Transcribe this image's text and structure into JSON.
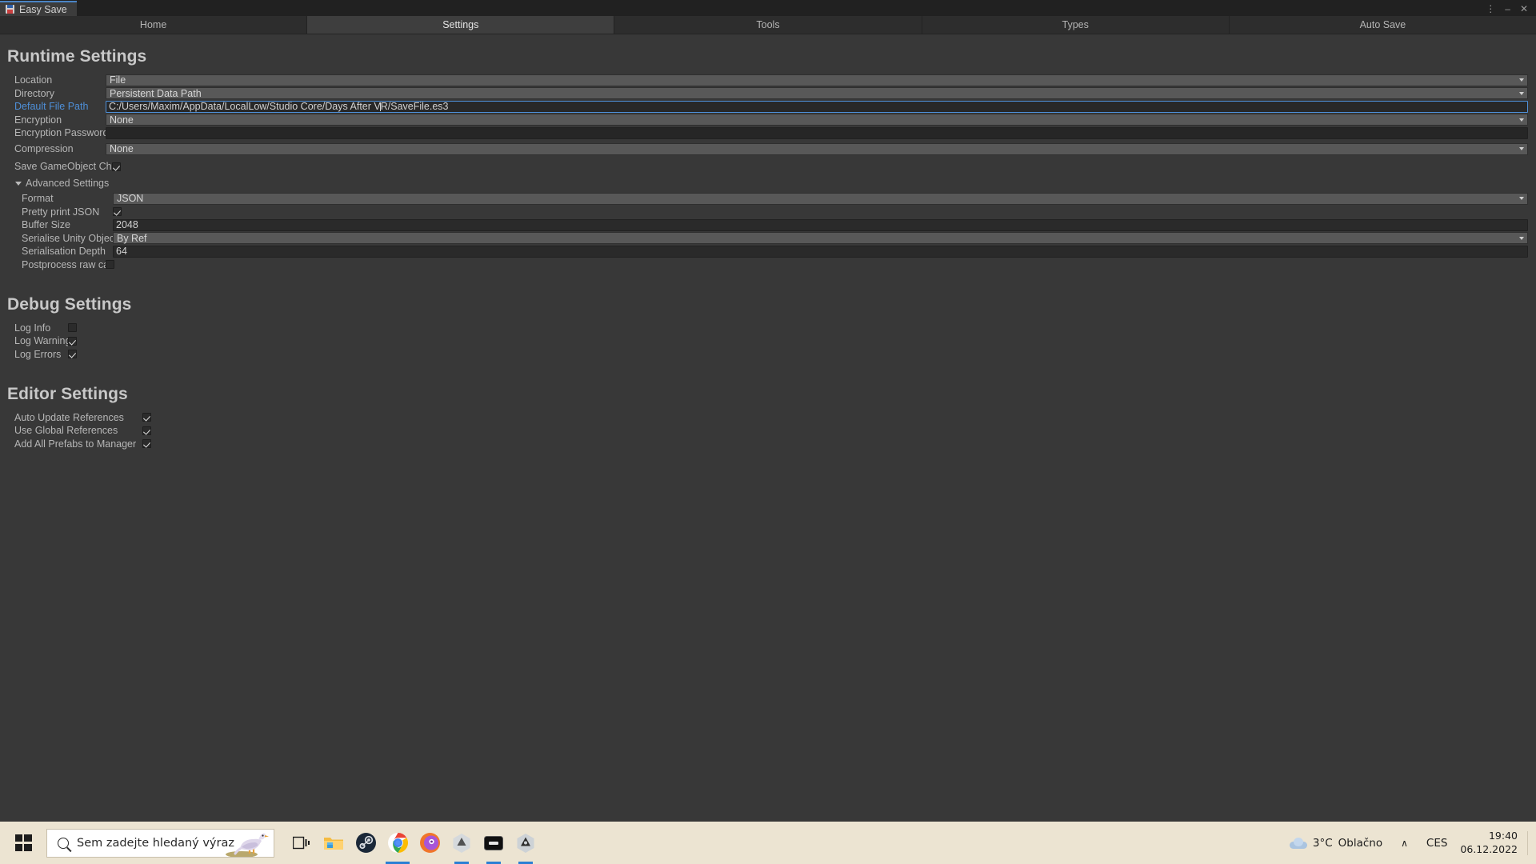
{
  "window": {
    "tab_title": "Easy Save",
    "icon": "easy-save-floppy-icon",
    "menu_glyph": "⋮",
    "minimize_glyph": "–",
    "close_glyph": "✕"
  },
  "tabs": [
    {
      "label": "Home",
      "selected": false
    },
    {
      "label": "Settings",
      "selected": true
    },
    {
      "label": "Tools",
      "selected": false
    },
    {
      "label": "Types",
      "selected": false
    },
    {
      "label": "Auto Save",
      "selected": false
    }
  ],
  "sections": {
    "runtime": {
      "title": "Runtime Settings",
      "location": {
        "label": "Location",
        "value": "File"
      },
      "directory": {
        "label": "Directory",
        "value": "Persistent Data Path"
      },
      "default_file_path": {
        "label": "Default File Path",
        "value_before_caret": "C:/Users/Maxim/AppData/LocalLow/Studio Core/Days After V",
        "value_after_caret": "R/SaveFile.es3",
        "full_value": "C:/Users/Maxim/AppData/LocalLow/Studio Core/Days After VR/SaveFile.es3",
        "label_color": "#4e8fd8",
        "focused": true
      },
      "encryption": {
        "label": "Encryption",
        "value": "None"
      },
      "encryption_password": {
        "label": "Encryption Password",
        "value": ""
      },
      "compression": {
        "label": "Compression",
        "value": "None"
      },
      "save_children": {
        "label": "Save GameObject Children",
        "checked": true
      }
    },
    "advanced": {
      "title": "Advanced Settings",
      "expanded": true,
      "format": {
        "label": "Format",
        "value": "JSON"
      },
      "pretty_print": {
        "label": "Pretty print JSON",
        "checked": true
      },
      "buffer_size": {
        "label": "Buffer Size",
        "value": "2048"
      },
      "serialise_fields": {
        "label": "Serialise Unity Object fields",
        "value": "By Ref"
      },
      "serialisation_depth": {
        "label": "Serialisation Depth",
        "value": "64"
      },
      "postprocess": {
        "label": "Postprocess raw cached dat",
        "checked": false
      }
    },
    "debug": {
      "title": "Debug Settings",
      "log_info": {
        "label": "Log Info",
        "checked": false
      },
      "log_warnings": {
        "label": "Log Warnings",
        "checked": true
      },
      "log_errors": {
        "label": "Log Errors",
        "checked": true
      }
    },
    "editor": {
      "title": "Editor Settings",
      "auto_update_references": {
        "label": "Auto Update References",
        "checked": true
      },
      "use_global_references": {
        "label": "Use Global References",
        "checked": true
      },
      "add_all_prefabs": {
        "label": "Add All Prefabs to Manager",
        "checked": true
      }
    }
  },
  "taskbar": {
    "start_icon": "windows-logo-icon",
    "search": {
      "placeholder": "Sem zadejte hledaný výraz",
      "value": ""
    },
    "items": [
      {
        "name": "task-view-icon",
        "active": false
      },
      {
        "name": "file-explorer-icon",
        "active": false
      },
      {
        "name": "steam-icon",
        "active": false
      },
      {
        "name": "google-chrome-icon",
        "active": true
      },
      {
        "name": "opera-icon",
        "active": false
      },
      {
        "name": "unity-hub-icon",
        "active": true
      },
      {
        "name": "terminal-icon",
        "active": true
      },
      {
        "name": "unity-editor-icon",
        "active": true
      }
    ],
    "weather": {
      "temperature": "3°C",
      "condition": "Oblačno",
      "icon": "cloud-icon"
    },
    "chevron_glyph": "∧",
    "language": "CES",
    "time": "19:40",
    "date": "06.12.2022"
  }
}
